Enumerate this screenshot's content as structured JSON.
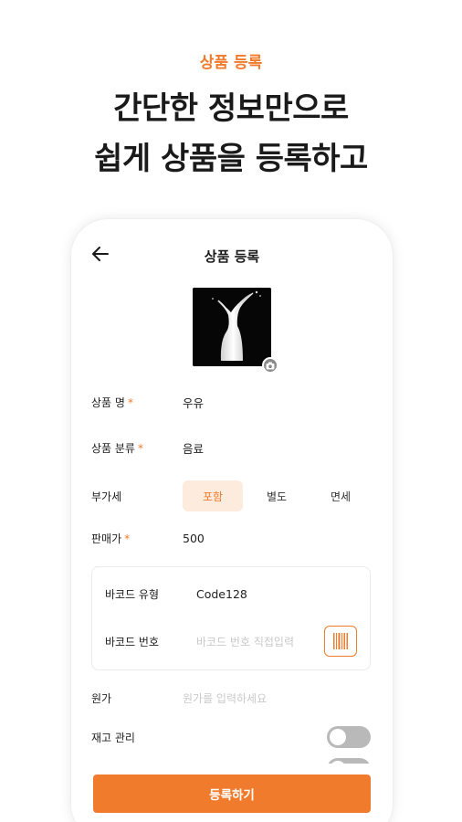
{
  "promo": {
    "tag": "상품 등록",
    "headline_line1": "간단한 정보만으로",
    "headline_line2": "쉽게 상품을 등록하고"
  },
  "screen": {
    "title": "상품 등록",
    "back_icon": "arrow-left-icon",
    "camera_icon": "camera-icon"
  },
  "form": {
    "product_name": {
      "label": "상품 명",
      "required_mark": "*",
      "value": "우유"
    },
    "category": {
      "label": "상품 분류",
      "required_mark": "*",
      "value": "음료"
    },
    "vat": {
      "label": "부가세",
      "options": [
        "포함",
        "별도",
        "면세"
      ],
      "selected": "포함"
    },
    "price": {
      "label": "판매가",
      "required_mark": "*",
      "value": "500"
    },
    "barcode_type": {
      "label": "바코드 유형",
      "value": "Code128"
    },
    "barcode_number": {
      "label": "바코드 번호",
      "placeholder": "바코드 번호 직접입력",
      "scan_icon": "barcode-scan-icon"
    },
    "cost": {
      "label": "원가",
      "placeholder": "원가를 입력하세요"
    },
    "inventory": {
      "label": "재고 관리",
      "enabled": false
    }
  },
  "submit_label": "등록하기",
  "colors": {
    "accent": "#f07b2c",
    "accent_light": "#fdebdd",
    "toggle_off": "#b9b9b9"
  }
}
